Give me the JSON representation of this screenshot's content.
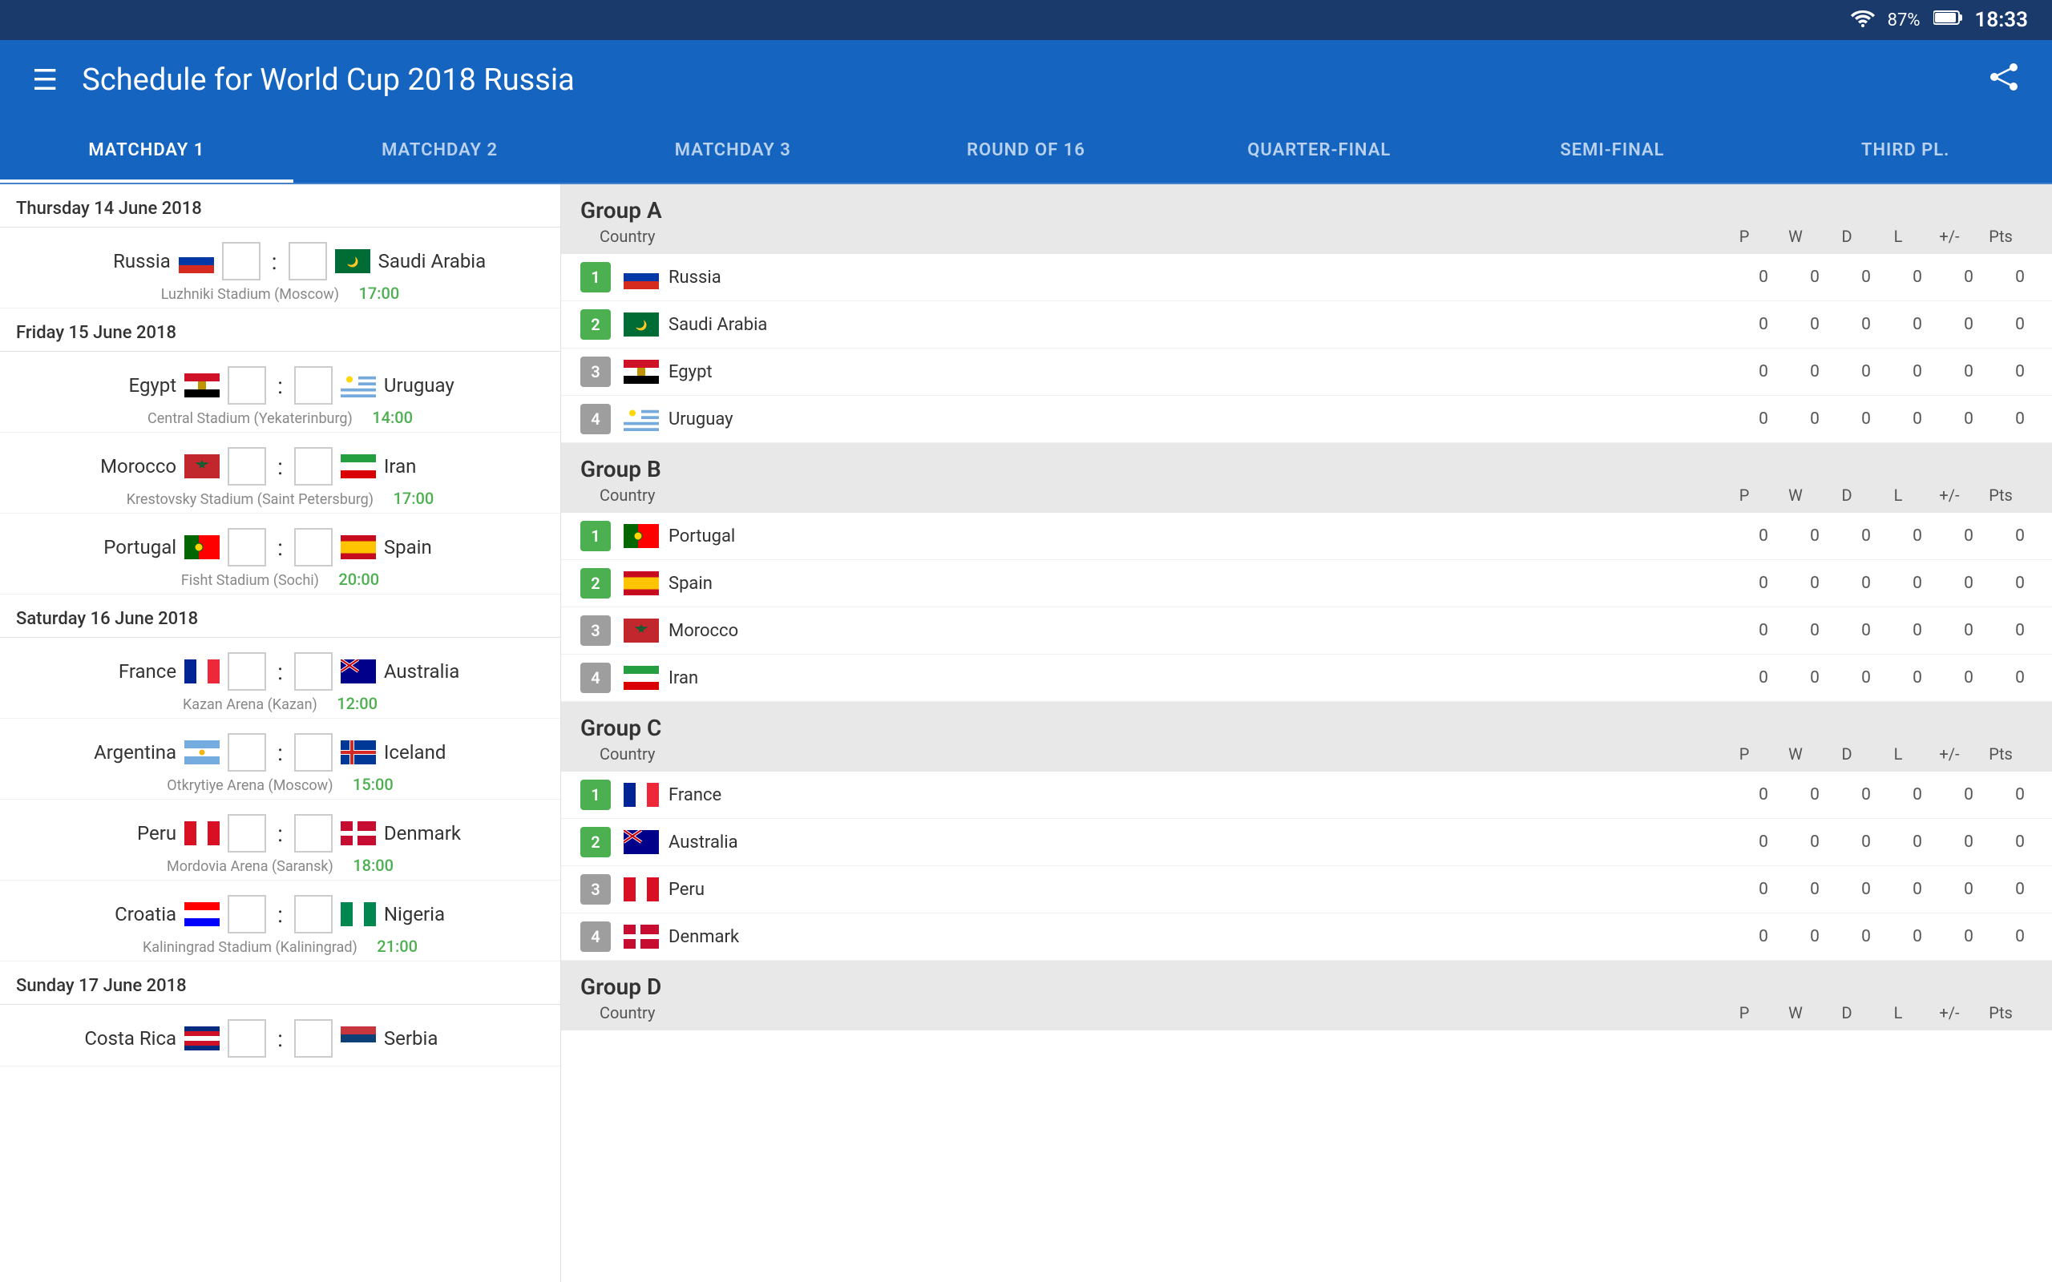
{
  "statusBar": {
    "battery": "87%",
    "time": "18:33"
  },
  "appBar": {
    "title": "Schedule for World Cup 2018 Russia"
  },
  "tabs": [
    {
      "label": "MATCHDAY 1",
      "active": true
    },
    {
      "label": "MATCHDAY 2",
      "active": false
    },
    {
      "label": "MATCHDAY 3",
      "active": false
    },
    {
      "label": "ROUND OF 16",
      "active": false
    },
    {
      "label": "QUARTER-FINAL",
      "active": false
    },
    {
      "label": "SEMI-FINAL",
      "active": false
    },
    {
      "label": "THIRD PL.",
      "active": false
    }
  ],
  "schedule": [
    {
      "day": "Thursday 14 June 2018",
      "matches": [
        {
          "home": "Russia",
          "homeFlagClass": "flag-russia",
          "away": "Saudi Arabia",
          "awayFlagClass": "flag-saudi",
          "venue": "Luzhniki Stadium (Moscow)",
          "time": "17:00"
        }
      ]
    },
    {
      "day": "Friday 15 June 2018",
      "matches": [
        {
          "home": "Egypt",
          "homeFlagClass": "flag-egypt",
          "away": "Uruguay",
          "awayFlagClass": "flag-uruguay",
          "venue": "Central Stadium (Yekaterinburg)",
          "time": "14:00"
        },
        {
          "home": "Morocco",
          "homeFlagClass": "flag-morocco",
          "away": "Iran",
          "awayFlagClass": "flag-iran",
          "venue": "Krestovsky Stadium (Saint Petersburg)",
          "time": "17:00"
        },
        {
          "home": "Portugal",
          "homeFlagClass": "flag-portugal",
          "away": "Spain",
          "awayFlagClass": "flag-spain",
          "venue": "Fisht Stadium (Sochi)",
          "time": "20:00"
        }
      ]
    },
    {
      "day": "Saturday 16 June 2018",
      "matches": [
        {
          "home": "France",
          "homeFlagClass": "flag-france",
          "away": "Australia",
          "awayFlagClass": "flag-australia",
          "venue": "Kazan Arena (Kazan)",
          "time": "12:00"
        },
        {
          "home": "Argentina",
          "homeFlagClass": "flag-argentina",
          "away": "Iceland",
          "awayFlagClass": "flag-iceland",
          "venue": "Otkrytiye Arena (Moscow)",
          "time": "15:00"
        },
        {
          "home": "Peru",
          "homeFlagClass": "flag-peru",
          "away": "Denmark",
          "awayFlagClass": "flag-denmark",
          "venue": "Mordovia Arena (Saransk)",
          "time": "18:00"
        },
        {
          "home": "Croatia",
          "homeFlagClass": "flag-croatia",
          "away": "Nigeria",
          "awayFlagClass": "flag-nigeria",
          "venue": "Kaliningrad Stadium (Kaliningrad)",
          "time": "21:00"
        }
      ]
    },
    {
      "day": "Sunday 17 June 2018",
      "matches": [
        {
          "home": "Costa Rica",
          "homeFlagClass": "flag-costa-rica",
          "away": "Serbia",
          "awayFlagClass": "flag-serbia",
          "venue": "",
          "time": ""
        }
      ]
    }
  ],
  "groups": [
    {
      "name": "Group A",
      "columnHeader": "Country",
      "statHeaders": [
        "P",
        "W",
        "D",
        "L",
        "+/-",
        "Pts"
      ],
      "teams": [
        {
          "rank": 1,
          "name": "Russia",
          "flagClass": "flag-russia",
          "p": 0,
          "w": 0,
          "d": 0,
          "l": 0,
          "gd": 0,
          "pts": 0
        },
        {
          "rank": 2,
          "name": "Saudi Arabia",
          "flagClass": "flag-saudi",
          "p": 0,
          "w": 0,
          "d": 0,
          "l": 0,
          "gd": 0,
          "pts": 0
        },
        {
          "rank": 3,
          "name": "Egypt",
          "flagClass": "flag-egypt",
          "p": 0,
          "w": 0,
          "d": 0,
          "l": 0,
          "gd": 0,
          "pts": 0
        },
        {
          "rank": 4,
          "name": "Uruguay",
          "flagClass": "flag-uruguay",
          "p": 0,
          "w": 0,
          "d": 0,
          "l": 0,
          "gd": 0,
          "pts": 0
        }
      ]
    },
    {
      "name": "Group B",
      "columnHeader": "Country",
      "statHeaders": [
        "P",
        "W",
        "D",
        "L",
        "+/-",
        "Pts"
      ],
      "teams": [
        {
          "rank": 1,
          "name": "Portugal",
          "flagClass": "flag-portugal",
          "p": 0,
          "w": 0,
          "d": 0,
          "l": 0,
          "gd": 0,
          "pts": 0
        },
        {
          "rank": 2,
          "name": "Spain",
          "flagClass": "flag-spain",
          "p": 0,
          "w": 0,
          "d": 0,
          "l": 0,
          "gd": 0,
          "pts": 0
        },
        {
          "rank": 3,
          "name": "Morocco",
          "flagClass": "flag-morocco",
          "p": 0,
          "w": 0,
          "d": 0,
          "l": 0,
          "gd": 0,
          "pts": 0
        },
        {
          "rank": 4,
          "name": "Iran",
          "flagClass": "flag-iran",
          "p": 0,
          "w": 0,
          "d": 0,
          "l": 0,
          "gd": 0,
          "pts": 0
        }
      ]
    },
    {
      "name": "Group C",
      "columnHeader": "Country",
      "statHeaders": [
        "P",
        "W",
        "D",
        "L",
        "+/-",
        "Pts"
      ],
      "teams": [
        {
          "rank": 1,
          "name": "France",
          "flagClass": "flag-france",
          "p": 0,
          "w": 0,
          "d": 0,
          "l": 0,
          "gd": 0,
          "pts": 0
        },
        {
          "rank": 2,
          "name": "Australia",
          "flagClass": "flag-australia",
          "p": 0,
          "w": 0,
          "d": 0,
          "l": 0,
          "gd": 0,
          "pts": 0
        },
        {
          "rank": 3,
          "name": "Peru",
          "flagClass": "flag-peru",
          "p": 0,
          "w": 0,
          "d": 0,
          "l": 0,
          "gd": 0,
          "pts": 0
        },
        {
          "rank": 4,
          "name": "Denmark",
          "flagClass": "flag-denmark",
          "p": 0,
          "w": 0,
          "d": 0,
          "l": 0,
          "gd": 0,
          "pts": 0
        }
      ]
    },
    {
      "name": "Group D",
      "columnHeader": "Country",
      "statHeaders": [
        "P",
        "W",
        "D",
        "L",
        "+/-",
        "Pts"
      ],
      "teams": []
    }
  ]
}
